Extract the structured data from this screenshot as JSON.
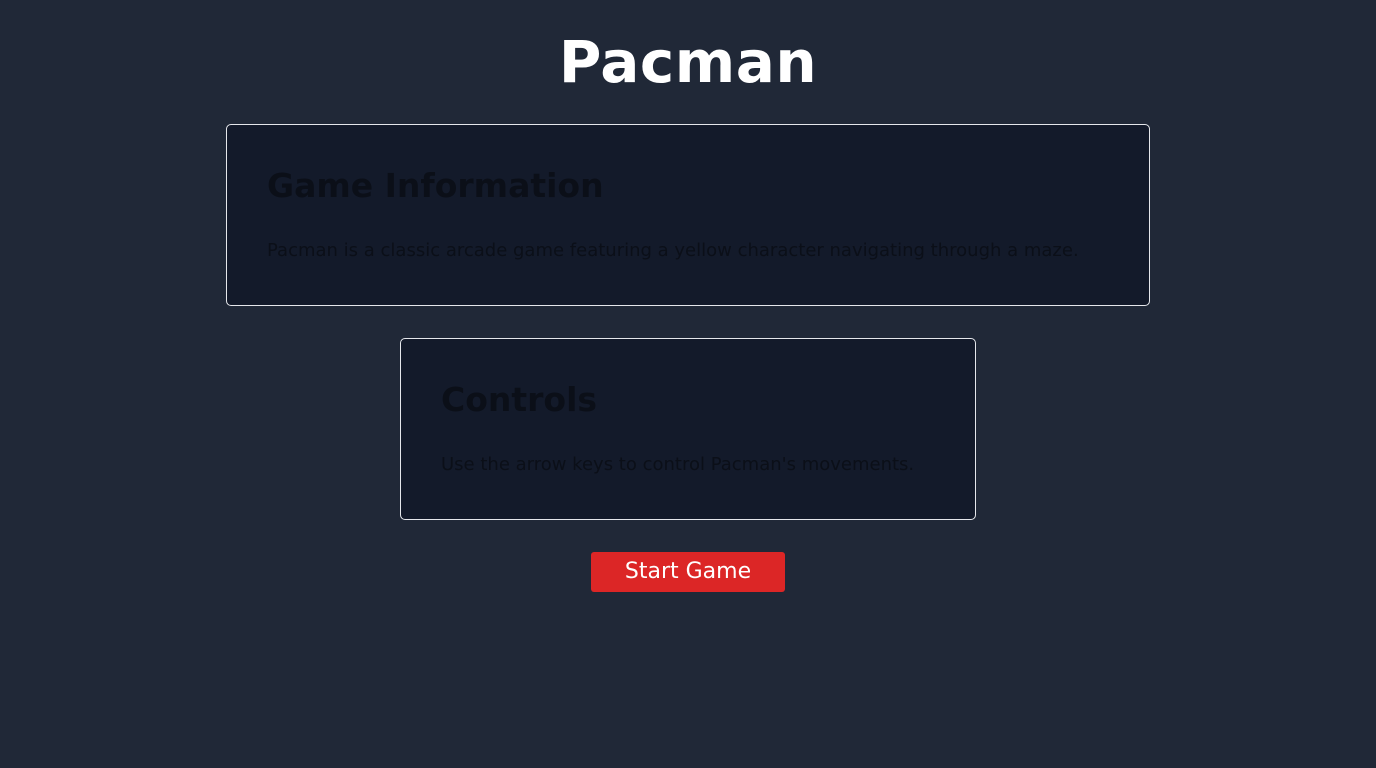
{
  "header": {
    "title": "Pacman"
  },
  "cards": {
    "info": {
      "heading": "Game Information",
      "text": "Pacman is a classic arcade game featuring a yellow character navigating through a maze."
    },
    "controls": {
      "heading": "Controls",
      "text": "Use the arrow keys to control Pacman's movements."
    }
  },
  "actions": {
    "start_label": "Start Game"
  },
  "colors": {
    "background": "#202837",
    "card_background": "#131a2a",
    "card_border": "#e5e7eb",
    "button": "#dc2626",
    "title_text": "#ffffff"
  }
}
